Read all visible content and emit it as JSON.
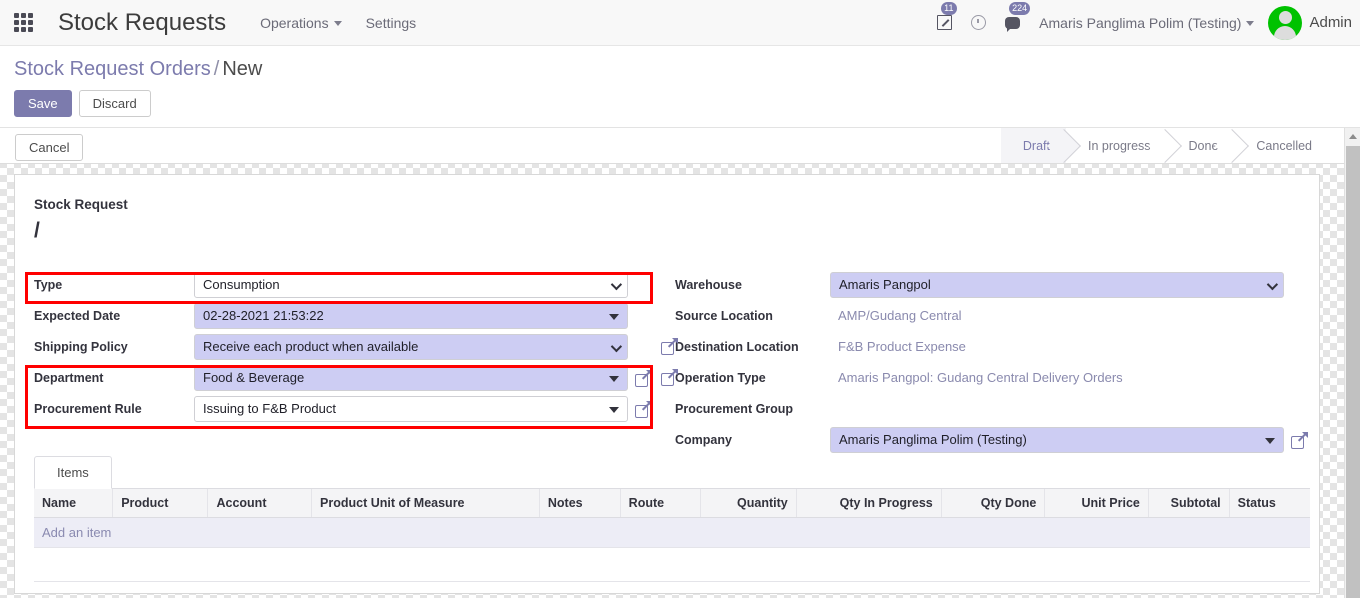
{
  "navbar": {
    "apps_icon": "apps-grid-icon",
    "brand": "Stock Requests",
    "menus": [
      {
        "label": "Operations",
        "has_caret": true
      },
      {
        "label": "Settings",
        "has_caret": false
      }
    ],
    "activity_badge": "11",
    "messages_badge": "224",
    "user_name": "Amaris Panglima Polim (Testing)",
    "admin_label": "Admin",
    "avatar_color": "#00c200"
  },
  "control_panel": {
    "breadcrumb_root": "Stock Request Orders",
    "breadcrumb_sep": "/",
    "breadcrumb_current": "New",
    "save_label": "Save",
    "discard_label": "Discard"
  },
  "subbar": {
    "cancel_label": "Cancel",
    "statuses": [
      {
        "label": "Draft",
        "active": true
      },
      {
        "label": "In progress",
        "active": false
      },
      {
        "label": "Done",
        "active": false
      },
      {
        "label": "Cancelled",
        "active": false
      }
    ]
  },
  "form": {
    "title": "Stock Request",
    "record_name": "/",
    "left_fields": [
      {
        "label": "Type",
        "value": "Consumption",
        "style": "white",
        "widget": "chevron",
        "highlight": true
      },
      {
        "label": "Expected Date",
        "value": "02-28-2021 21:53:22",
        "style": "filled",
        "widget": "triangle",
        "highlight": false
      },
      {
        "label": "Shipping Policy",
        "value": "Receive each product when available",
        "style": "filled",
        "widget": "chevron",
        "highlight": false
      },
      {
        "label": "Department",
        "value": "Food & Beverage",
        "style": "filled",
        "widget": "triangle",
        "highlight": true,
        "external_link": true
      },
      {
        "label": "Procurement Rule",
        "value": "Issuing to F&B Product",
        "style": "white",
        "widget": "triangle",
        "highlight": true,
        "external_link": true
      }
    ],
    "right_fields": [
      {
        "label": "Warehouse",
        "value": "Amaris Pangpol",
        "style": "filled",
        "widget": "chevron",
        "readonly": false
      },
      {
        "label": "Source Location",
        "value": "AMP/Gudang Central",
        "readonly": true
      },
      {
        "label": "Destination Location",
        "value": "F&B Product Expense",
        "readonly": true
      },
      {
        "label": "Operation Type",
        "value": "Amaris Pangpol: Gudang Central Delivery Orders",
        "readonly": true
      },
      {
        "label": "Procurement Group",
        "value": "",
        "readonly": true
      },
      {
        "label": "Company",
        "value": "Amaris Panglima Polim (Testing)",
        "style": "filled",
        "widget": "triangle",
        "readonly": false,
        "external_link": true
      }
    ],
    "highlight_color": "#ff0000",
    "field_fill_color": "#cdcdf3"
  },
  "notebook": {
    "tabs": [
      {
        "label": "Items",
        "active": true
      }
    ],
    "columns": [
      {
        "label": "Name",
        "align": "left"
      },
      {
        "label": "Product",
        "align": "left"
      },
      {
        "label": "Account",
        "align": "left"
      },
      {
        "label": "Product Unit of Measure",
        "align": "left"
      },
      {
        "label": "Notes",
        "align": "left"
      },
      {
        "label": "Route",
        "align": "left"
      },
      {
        "label": "Quantity",
        "align": "right"
      },
      {
        "label": "Qty In Progress",
        "align": "right"
      },
      {
        "label": "Qty Done",
        "align": "right"
      },
      {
        "label": "Unit Price",
        "align": "right"
      },
      {
        "label": "Subtotal",
        "align": "right"
      },
      {
        "label": "Status",
        "align": "left"
      }
    ],
    "rows": [],
    "add_item_label": "Add an item"
  }
}
